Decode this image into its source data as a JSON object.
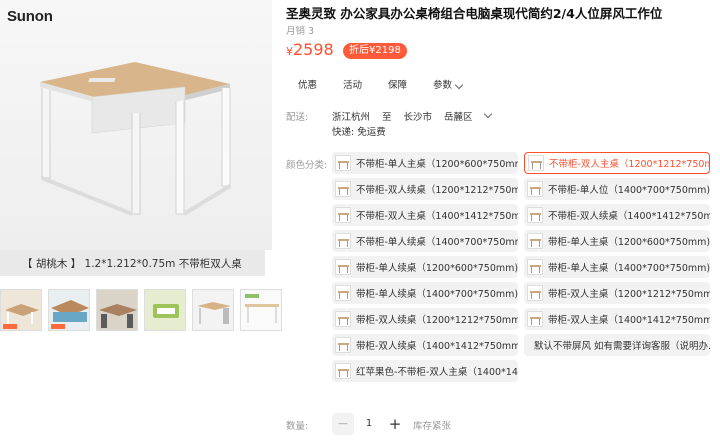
{
  "gallery": {
    "brand": "Sunon",
    "caption": "【 胡桃木 】   1.2*1.212*0.75m 不带柜双人桌",
    "thumbnails": [
      "thumb-1",
      "thumb-2",
      "thumb-3",
      "thumb-4",
      "thumb-5",
      "thumb-6"
    ]
  },
  "product": {
    "title": "圣奥灵致 办公家具办公桌椅组合电脑桌现代简约2/4人位屏风工作位",
    "sales": "月销 3",
    "price_symbol": "¥",
    "price": "2598",
    "discount": "折后¥2198"
  },
  "tabs": {
    "coupon": "优惠",
    "activity": "活动",
    "guarantee": "保障",
    "params": "参数"
  },
  "shipping": {
    "label": "配送:",
    "from": "浙江杭州",
    "to_word": "至",
    "city": "长沙市",
    "district": "岳麓区",
    "express": "快递: 免运费"
  },
  "options": {
    "label": "颜色分类:",
    "items": [
      "不带柜-单人主桌（1200*600*750mm)...",
      "不带柜-双人主桌（1200*1212*750mm...",
      "不带柜-双人续桌（1200*1212*750mm...",
      "不带柜-单人位（1400*700*750mm)...",
      "不带柜-双人主桌（1400*1412*750mm...",
      "不带柜-双人续桌（1400*1412*750mm...",
      "不带柜-单人续桌（1400*700*750mm...",
      "带柜-单人主桌（1200*600*750mm)",
      "带柜-单人续桌（1200*600*750mm)",
      "带柜-单人主桌（1400*700*750mm)",
      "带柜-单人续桌（1400*700*750mm)",
      "带柜-双人主桌（1200*1212*750mm)",
      "带柜-双人续桌（1200*1212*750mm)",
      "带柜-双人主桌（1400*1412*750mm)",
      "带柜-双人续桌（1400*1412*750mm)...",
      "默认不带屏风 如有需要详询客服（说明办...",
      "红苹果色-不带柜-双人主桌（1400*141..."
    ],
    "selected_index": 1
  },
  "quantity": {
    "label": "数量:",
    "minus": "−",
    "value": "1",
    "plus": "+",
    "stock": "库存紧张"
  },
  "colors": {
    "accent": "#ff4f2d",
    "badge": "#ff5b3a"
  }
}
